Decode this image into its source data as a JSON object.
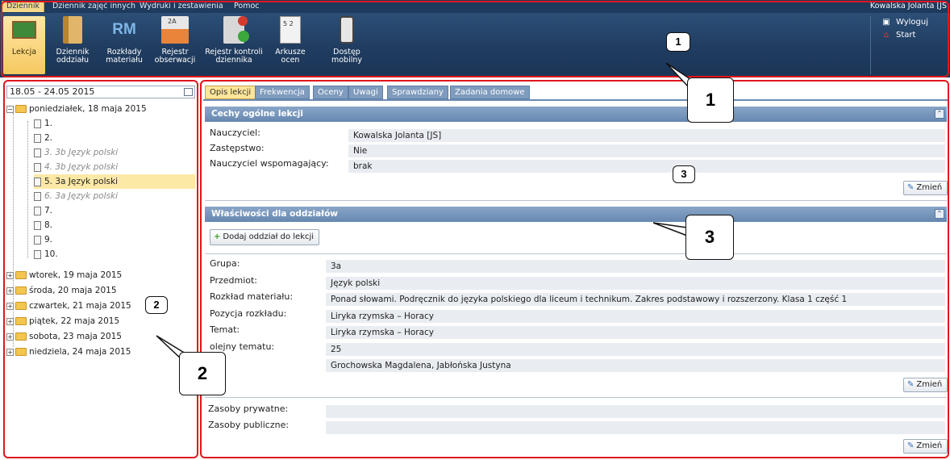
{
  "menu": {
    "items": [
      "Dziennik",
      "Dziennik zajęć innych",
      "Wydruki i zestawienia",
      "Pomoc"
    ],
    "user": "Kowalska Jolanta [JS"
  },
  "ribbon": {
    "buttons": [
      {
        "label": "Lekcja",
        "icon": "chalkboard-icon"
      },
      {
        "label": "Dziennik\noddziału",
        "icon": "book-icon"
      },
      {
        "label": "Rozkłady\nmateriału",
        "icon": "rm-icon",
        "glyph": "RM"
      },
      {
        "label": "Rejestr\nobserwacji",
        "icon": "folder-icon",
        "glyph": "2A"
      },
      {
        "label": "Rejestr kontroli\ndziennika",
        "icon": "control-register-icon"
      },
      {
        "label": "Arkusze\nocen",
        "icon": "grade-sheet-icon",
        "glyph": "5 2"
      },
      {
        "label": "Dostęp\nmobilny",
        "icon": "mobile-phone-icon"
      }
    ],
    "logout": "Wyloguj",
    "start": "Start"
  },
  "callouts": {
    "one": "1",
    "two": "2",
    "three": "3"
  },
  "tree": {
    "date_range": "18.05 - 24.05 2015",
    "open_day": "poniedziałek, 18 maja 2015",
    "lessons": [
      {
        "label": "1.",
        "dim": false,
        "selected": false
      },
      {
        "label": "2.",
        "dim": false,
        "selected": false
      },
      {
        "label": "3. 3b Język polski",
        "dim": true,
        "selected": false
      },
      {
        "label": "4. 3b Język polski",
        "dim": true,
        "selected": false
      },
      {
        "label": "5. 3a Język polski",
        "dim": false,
        "selected": true
      },
      {
        "label": "6. 3a Język polski",
        "dim": true,
        "selected": false
      },
      {
        "label": "7.",
        "dim": false,
        "selected": false
      },
      {
        "label": "8.",
        "dim": false,
        "selected": false
      },
      {
        "label": "9.",
        "dim": false,
        "selected": false
      },
      {
        "label": "10.",
        "dim": false,
        "selected": false
      }
    ],
    "days": [
      "wtorek, 19 maja 2015",
      "środa, 20 maja 2015",
      "czwartek, 21 maja 2015",
      "piątek, 22 maja 2015",
      "sobota, 23 maja 2015",
      "niedziela, 24 maja 2015"
    ]
  },
  "tabs": [
    "Opis lekcji",
    "Frekwencja",
    "Oceny",
    "Uwagi",
    "Sprawdziany",
    "Zadania domowe"
  ],
  "general": {
    "header": "Cechy ogólne lekcji",
    "fields": [
      {
        "label": "Nauczyciel:",
        "value": "Kowalska Jolanta [JS]"
      },
      {
        "label": "Zastępstwo:",
        "value": "Nie"
      },
      {
        "label": "Nauczyciel wspomagający:",
        "value": "brak"
      }
    ],
    "change": "Zmień"
  },
  "classes": {
    "header": "Właściwości dla oddziałów",
    "add_button": "Dodaj oddział do lekcji",
    "fields": [
      {
        "label": "Grupa:",
        "value": "3a"
      },
      {
        "label": "Przedmiot:",
        "value": "Język polski"
      },
      {
        "label": "Rozkład materiału:",
        "value": "Ponad słowami. Podręcznik do języka polskiego dla liceum i technikum. Zakres podstawowy i rozszerzony. Klasa 1 część 1"
      },
      {
        "label": "Pozycja rozkładu:",
        "value": "Liryka rzymska – Horacy"
      },
      {
        "label": "Temat:",
        "value": "Liryka rzymska – Horacy"
      },
      {
        "label": "olejny tematu:",
        "value": "25"
      },
      {
        "label": "mi:",
        "value": "Grochowska Magdalena, Jabłońska Justyna"
      }
    ],
    "change": "Zmień"
  },
  "resources": {
    "fields": [
      {
        "label": "Zasoby prywatne:",
        "value": ""
      },
      {
        "label": "Zasoby publiczne:",
        "value": ""
      }
    ],
    "change": "Zmień"
  }
}
